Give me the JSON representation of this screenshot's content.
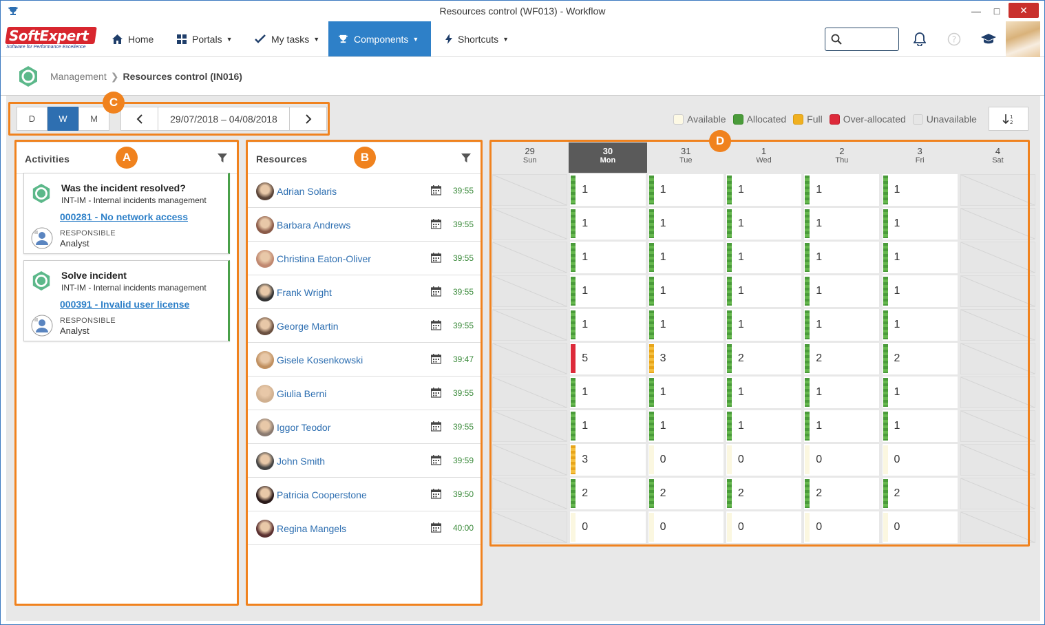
{
  "window": {
    "title": "Resources control (WF013) - Workflow"
  },
  "nav": {
    "brand_top": "SoftExpert",
    "brand_tagline": "Software for Performance Excellence",
    "home": "Home",
    "portals": "Portals",
    "mytasks": "My tasks",
    "components": "Components",
    "shortcuts": "Shortcuts"
  },
  "breadcrumb": {
    "parent": "Management",
    "current": "Resources control (IN016)"
  },
  "toolbar": {
    "view_day": "D",
    "view_week": "W",
    "view_month": "M",
    "date_range": "29/07/2018 – 04/08/2018"
  },
  "legend": {
    "available": "Available",
    "allocated": "Allocated",
    "full": "Full",
    "over": "Over-allocated",
    "unavailable": "Unavailable"
  },
  "colors": {
    "accent": "#2e80c8",
    "allocated": "#4a9b3a",
    "full": "#e8a51a",
    "over": "#dd2a3a",
    "highlight": "#f0821e"
  },
  "markers": {
    "a": "A",
    "b": "B",
    "c": "C",
    "d": "D"
  },
  "activities": {
    "title": "Activities",
    "items": [
      {
        "title": "Was the incident resolved?",
        "process": "INT-IM - Internal incidents management",
        "link": "000281 - No network access",
        "resp_label": "RESPONSIBLE",
        "resp_value": "Analyst"
      },
      {
        "title": "Solve incident",
        "process": "INT-IM - Internal incidents management",
        "link": "000391 - Invalid user license",
        "resp_label": "RESPONSIBLE",
        "resp_value": "Analyst"
      }
    ]
  },
  "resources": {
    "title": "Resources",
    "items": [
      {
        "name": "Adrian Solaris",
        "hours": "39:55"
      },
      {
        "name": "Barbara Andrews",
        "hours": "39:55"
      },
      {
        "name": "Christina Eaton-Oliver",
        "hours": "39:55"
      },
      {
        "name": "Frank Wright",
        "hours": "39:55"
      },
      {
        "name": "George Martin",
        "hours": "39:55"
      },
      {
        "name": "Gisele Kosenkowski",
        "hours": "39:47"
      },
      {
        "name": "Giulia Berni",
        "hours": "39:55"
      },
      {
        "name": "Iggor Teodor",
        "hours": "39:55"
      },
      {
        "name": "John Smith",
        "hours": "39:59"
      },
      {
        "name": "Patricia Cooperstone",
        "hours": "39:50"
      },
      {
        "name": "Regina Mangels",
        "hours": "40:00"
      }
    ]
  },
  "calendar": {
    "days": [
      {
        "d": "29",
        "w": "Sun"
      },
      {
        "d": "30",
        "w": "Mon"
      },
      {
        "d": "31",
        "w": "Tue"
      },
      {
        "d": "1",
        "w": "Wed"
      },
      {
        "d": "2",
        "w": "Thu"
      },
      {
        "d": "3",
        "w": "Fri"
      },
      {
        "d": "4",
        "w": "Sat"
      }
    ],
    "today_index": 1,
    "rows": [
      [
        [
          "u",
          ""
        ],
        [
          "g",
          "1"
        ],
        [
          "g",
          "1"
        ],
        [
          "g",
          "1"
        ],
        [
          "g",
          "1"
        ],
        [
          "g",
          "1"
        ],
        [
          "u",
          ""
        ]
      ],
      [
        [
          "u",
          ""
        ],
        [
          "g",
          "1"
        ],
        [
          "g",
          "1"
        ],
        [
          "g",
          "1"
        ],
        [
          "g",
          "1"
        ],
        [
          "g",
          "1"
        ],
        [
          "u",
          ""
        ]
      ],
      [
        [
          "u",
          ""
        ],
        [
          "g",
          "1"
        ],
        [
          "g",
          "1"
        ],
        [
          "g",
          "1"
        ],
        [
          "g",
          "1"
        ],
        [
          "g",
          "1"
        ],
        [
          "u",
          ""
        ]
      ],
      [
        [
          "u",
          ""
        ],
        [
          "g",
          "1"
        ],
        [
          "g",
          "1"
        ],
        [
          "g",
          "1"
        ],
        [
          "g",
          "1"
        ],
        [
          "g",
          "1"
        ],
        [
          "u",
          ""
        ]
      ],
      [
        [
          "u",
          ""
        ],
        [
          "g",
          "1"
        ],
        [
          "g",
          "1"
        ],
        [
          "g",
          "1"
        ],
        [
          "g",
          "1"
        ],
        [
          "g",
          "1"
        ],
        [
          "u",
          ""
        ]
      ],
      [
        [
          "u",
          ""
        ],
        [
          "r",
          "5"
        ],
        [
          "y",
          "3"
        ],
        [
          "g",
          "2"
        ],
        [
          "g",
          "2"
        ],
        [
          "g",
          "2"
        ],
        [
          "u",
          ""
        ]
      ],
      [
        [
          "u",
          ""
        ],
        [
          "g",
          "1"
        ],
        [
          "g",
          "1"
        ],
        [
          "g",
          "1"
        ],
        [
          "g",
          "1"
        ],
        [
          "g",
          "1"
        ],
        [
          "u",
          ""
        ]
      ],
      [
        [
          "u",
          ""
        ],
        [
          "g",
          "1"
        ],
        [
          "g",
          "1"
        ],
        [
          "g",
          "1"
        ],
        [
          "g",
          "1"
        ],
        [
          "g",
          "1"
        ],
        [
          "u",
          ""
        ]
      ],
      [
        [
          "u",
          ""
        ],
        [
          "y",
          "3"
        ],
        [
          "a",
          "0"
        ],
        [
          "a",
          "0"
        ],
        [
          "a",
          "0"
        ],
        [
          "a",
          "0"
        ],
        [
          "u",
          ""
        ]
      ],
      [
        [
          "u",
          ""
        ],
        [
          "g",
          "2"
        ],
        [
          "g",
          "2"
        ],
        [
          "g",
          "2"
        ],
        [
          "g",
          "2"
        ],
        [
          "g",
          "2"
        ],
        [
          "u",
          ""
        ]
      ],
      [
        [
          "u",
          ""
        ],
        [
          "a",
          "0"
        ],
        [
          "a",
          "0"
        ],
        [
          "a",
          "0"
        ],
        [
          "a",
          "0"
        ],
        [
          "a",
          "0"
        ],
        [
          "u",
          ""
        ]
      ]
    ]
  }
}
